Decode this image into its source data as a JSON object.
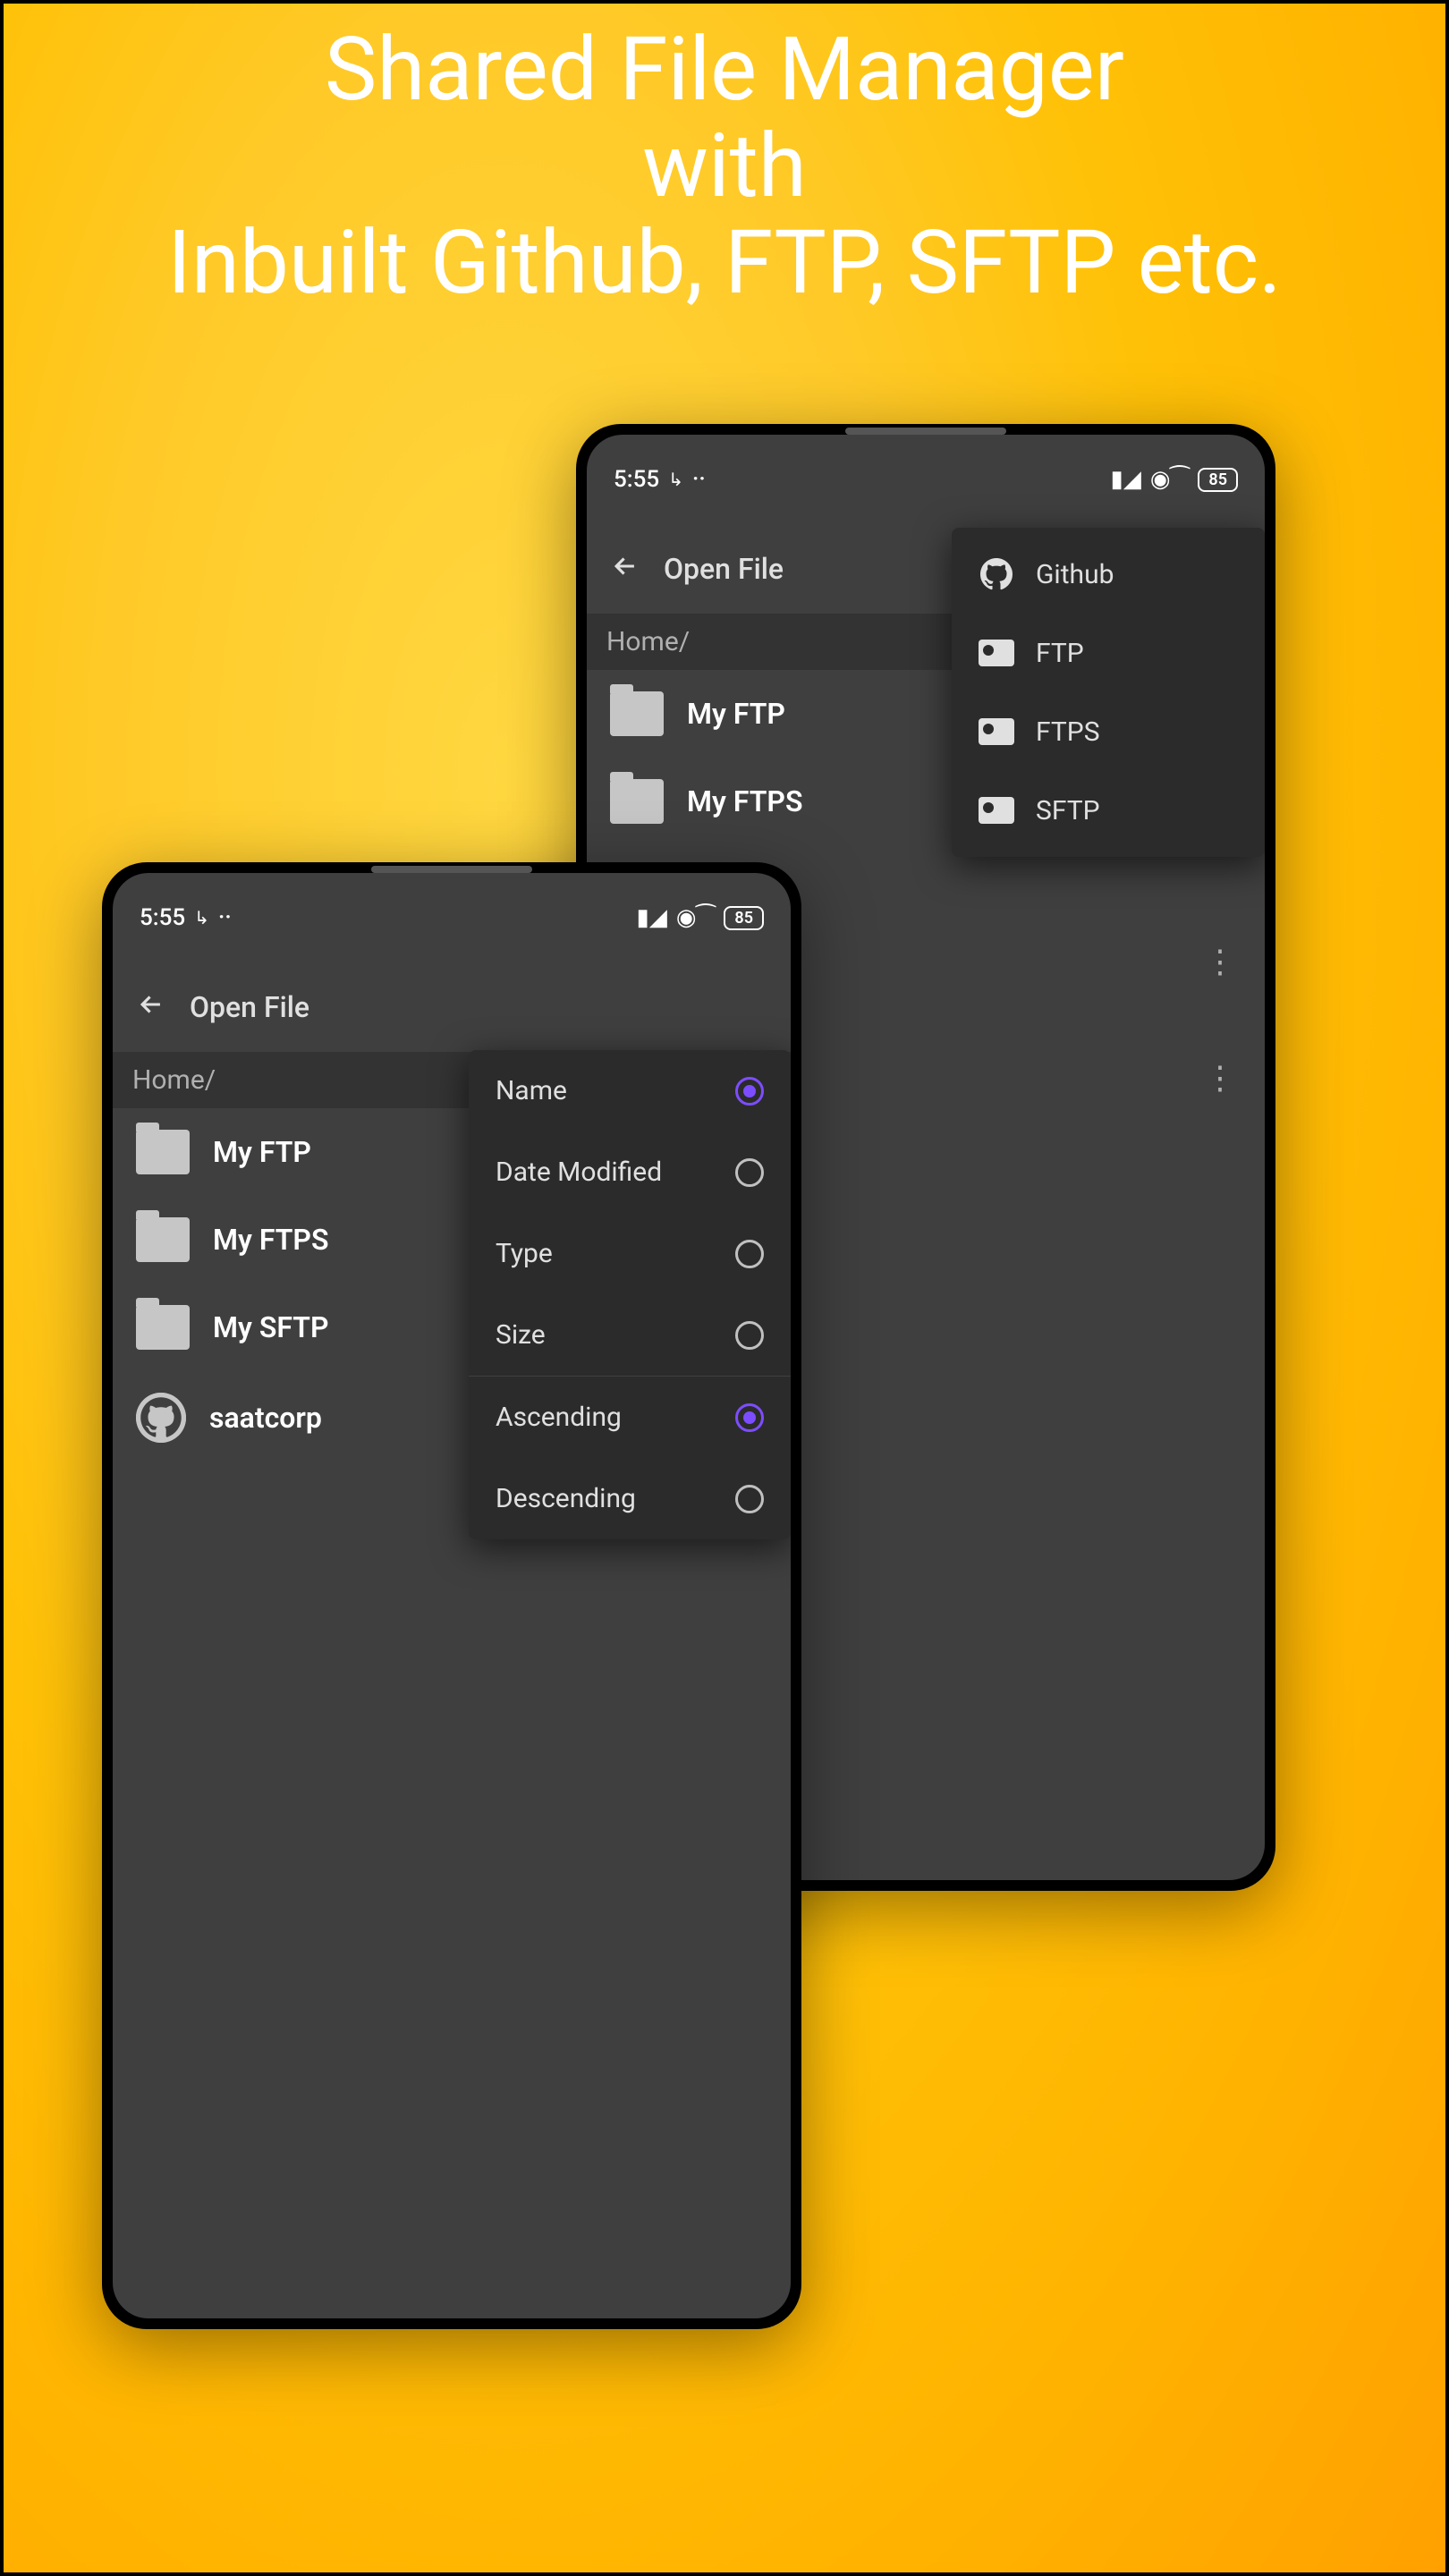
{
  "promo": {
    "line1": "Shared File Manager",
    "line2": "with",
    "line3": "Inbuilt Github, FTP, SFTP etc."
  },
  "status": {
    "time": "5:55",
    "indicator1": "↳",
    "indicator2": "··",
    "battery": "85"
  },
  "toolbar": {
    "title": "Open File",
    "breadcrumb": "Home/"
  },
  "files": [
    {
      "name": "My FTP",
      "icon": "folder"
    },
    {
      "name": "My FTPS",
      "icon": "folder"
    },
    {
      "name": "My SFTP",
      "icon": "folder"
    },
    {
      "name": "saatcorp",
      "icon": "github"
    }
  ],
  "sort_menu": {
    "sort_by": [
      {
        "label": "Name",
        "selected": true
      },
      {
        "label": "Date Modified",
        "selected": false
      },
      {
        "label": "Type",
        "selected": false
      },
      {
        "label": "Size",
        "selected": false
      }
    ],
    "direction": [
      {
        "label": "Ascending",
        "selected": true
      },
      {
        "label": "Descending",
        "selected": false
      }
    ]
  },
  "add_menu": [
    {
      "label": "Github",
      "icon": "github"
    },
    {
      "label": "FTP",
      "icon": "card"
    },
    {
      "label": "FTPS",
      "icon": "card"
    },
    {
      "label": "SFTP",
      "icon": "card"
    }
  ],
  "back_phone_files": [
    {
      "name": "My FTP",
      "icon": "folder"
    },
    {
      "name": "My FTPS",
      "icon": "folder"
    }
  ]
}
